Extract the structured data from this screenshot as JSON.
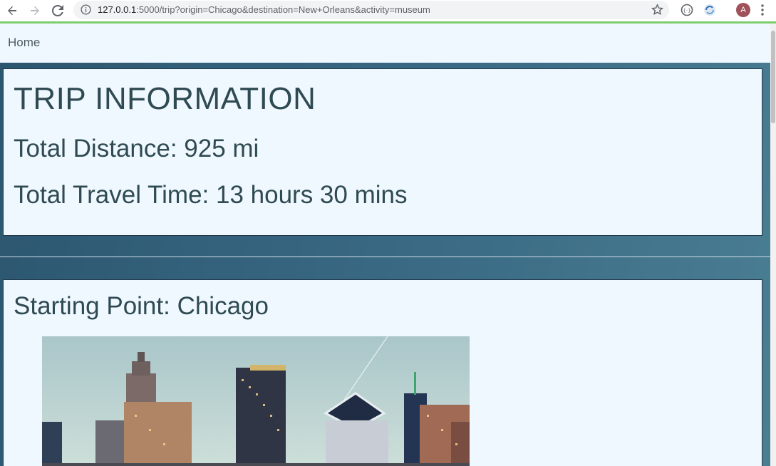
{
  "browser": {
    "url_host": "127.0.0.1",
    "url_rest": ":5000/trip?origin=Chicago&destination=New+Orleans&activity=museum",
    "avatar_initial": "A",
    "icons": [
      "back-icon",
      "forward-icon",
      "reload-icon",
      "info-icon",
      "star-icon",
      "extension-icon",
      "extension-refresh-icon",
      "menu-icon"
    ]
  },
  "nav": {
    "home_label": "Home"
  },
  "trip": {
    "title": "TRIP INFORMATION",
    "distance": "Total Distance: 925 mi",
    "travel_time": "Total Travel Time: 13 hours 30 mins"
  },
  "start": {
    "heading": "Starting Point: Chicago"
  },
  "colors": {
    "page_bg": "#3a6a84",
    "card_bg": "#f0f8ff",
    "text": "#2f4a52",
    "load_bar": "#7dcd6d"
  }
}
